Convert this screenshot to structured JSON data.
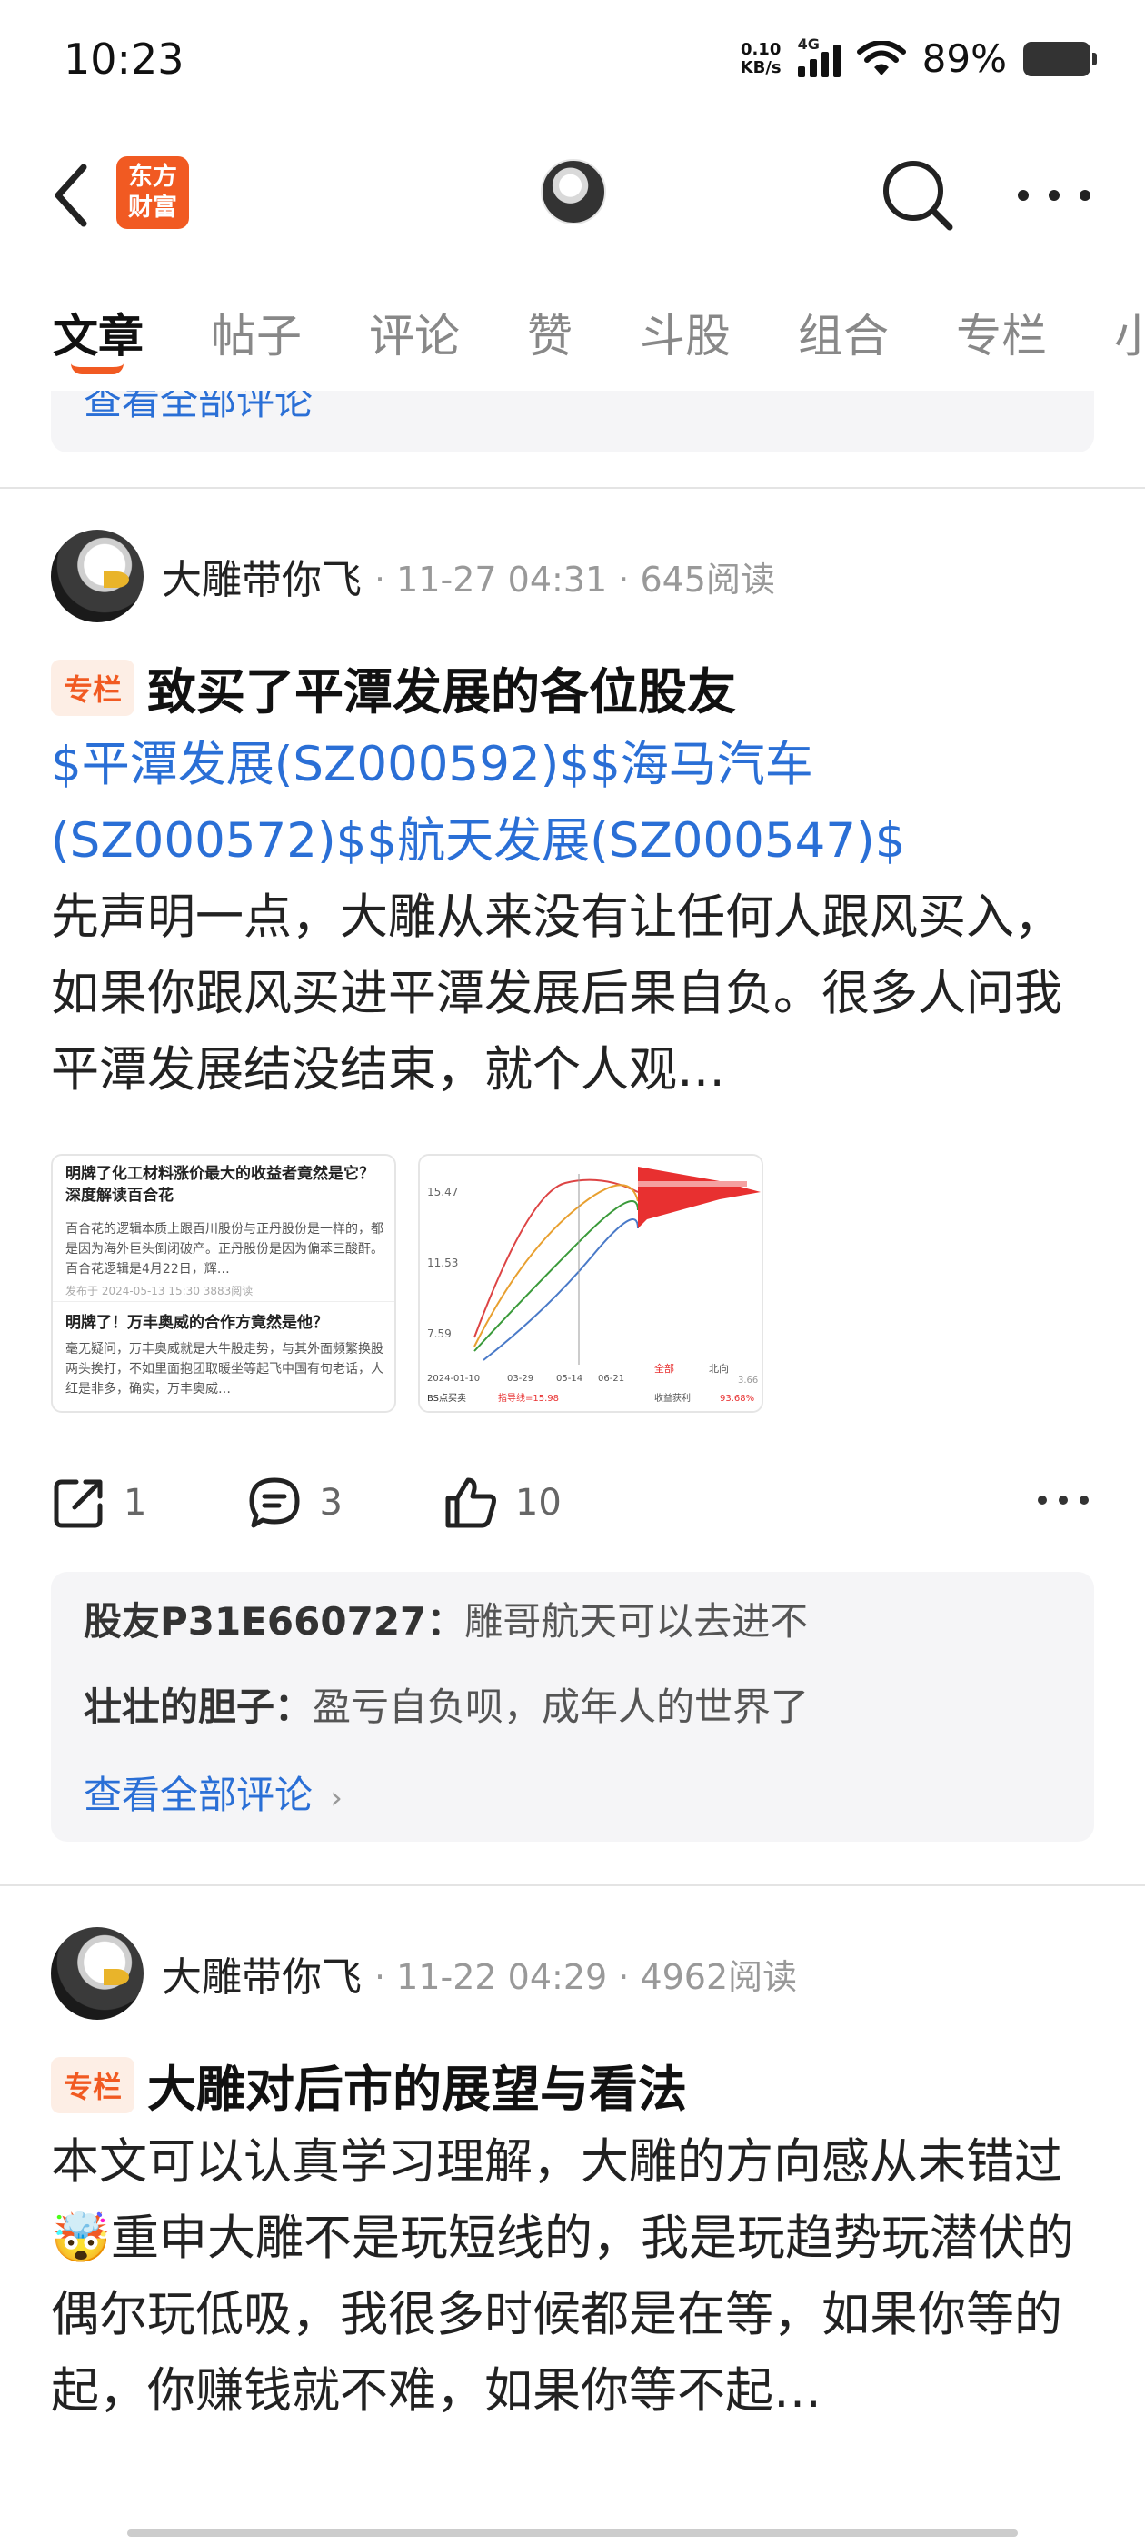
{
  "status_bar": {
    "time": "10:23",
    "speed_value": "0.10",
    "speed_unit": "KB/s",
    "network": "4G",
    "battery": "89%"
  },
  "nav": {
    "logo_line1": "东方",
    "logo_line2": "财富",
    "logo_color": "#f15a22",
    "back_icon": "chevron-left-icon",
    "search_icon": "search-icon",
    "more_icon": "more-dots-icon"
  },
  "tabs": [
    {
      "label": "文章",
      "active": true
    },
    {
      "label": "帖子"
    },
    {
      "label": "评论"
    },
    {
      "label": "赞"
    },
    {
      "label": "斗股"
    },
    {
      "label": "组合"
    },
    {
      "label": "专栏"
    },
    {
      "label": "小"
    }
  ],
  "prev_see_all": "查看全部评论",
  "posts": [
    {
      "author": "大雕带你飞",
      "time": "11-27 04:31",
      "reads": "645阅读",
      "badge": "专栏",
      "title": "致买了平潭发展的各位股友",
      "tickers": "$平潭发展(SZ000592)$$海马汽车(SZ000572)$$航天发展(SZ000547)$",
      "body": "先声明一点，大雕从来没有让任何人跟风买入，如果你跟风买进平潭发展后果自负。很多人问我平潭发展结没结束，就个人观…",
      "thumb1": {
        "h1": "明牌了化工材料涨价最大的收益者竟然是它？深度解读百合花",
        "p1": "百合花的逻辑本质上跟百川股份与正丹股份是一样的，都是因为海外巨头倒闭破产。正丹股份是因为偏苯三酸酐。百合花逻辑是4月22日，辉…",
        "date": "发布于 2024-05-13 15:30 3883阅读",
        "h2": "明牌了！万丰奥威的合作方竟然是他？",
        "p2": "毫无疑问，万丰奥威就是大牛股走势，与其外面频繁换股两头挨打，不如里面抱团取暖坐等起飞中国有句老话，人红是非多，确实，万丰奥威…"
      },
      "thumb2": {
        "y1": "15.47",
        "y2": "11.53",
        "y3": "7.59",
        "y4": "3.66",
        "d1": "2024-01-10",
        "d2": "03-29",
        "d3": "05-14",
        "d4": "06-21",
        "label_bs": "BS点买卖",
        "label_ind": "指导线=15.98",
        "label_all": "全部",
        "label_north": "北向",
        "label_profit": "收益获利",
        "profit_value": "93.68%"
      },
      "shares": "1",
      "comments_count": "3",
      "likes": "10",
      "comments": [
        {
          "user": "股友P31E660727：",
          "text": "雕哥航天可以去进不"
        },
        {
          "user": "壮壮的胆子：",
          "text": "盈亏自负呗，成年人的世界了"
        }
      ],
      "see_all": "查看全部评论"
    },
    {
      "author": "大雕带你飞",
      "time": "11-22 04:29",
      "reads": "4962阅读",
      "badge": "专栏",
      "title": "大雕对后市的展望与看法",
      "body": "本文可以认真学习理解，大雕的方向感从未错过🤯重申大雕不是玩短线的，我是玩趋势玩潜伏的偶尔玩低吸，我很多时候都是在等，如果你等的起，你赚钱就不难，如果你等不起…"
    }
  ],
  "colors": {
    "accent": "#f15a22",
    "link": "#2a6fd6"
  }
}
